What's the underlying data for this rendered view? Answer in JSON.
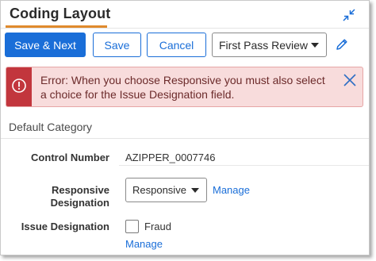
{
  "header": {
    "title": "Coding Layout"
  },
  "toolbar": {
    "save_next_label": "Save & Next",
    "save_label": "Save",
    "cancel_label": "Cancel",
    "layout_selected": "First Pass Review"
  },
  "error": {
    "message": "Error: When you choose Responsive you must also select a choice for the Issue Designation field."
  },
  "section": {
    "category": "Default Category"
  },
  "fields": {
    "control_number": {
      "label": "Control Number",
      "value": "AZIPPER_0007746"
    },
    "responsive": {
      "label": "Responsive Designation",
      "selected": "Responsive",
      "manage_label": "Manage"
    },
    "issue": {
      "label": "Issue Designation",
      "choices": [
        {
          "label": "Fraud",
          "checked": false
        }
      ],
      "manage_label": "Manage"
    }
  },
  "colors": {
    "primary": "#1a6ed8",
    "accent_underline": "#e08a2d",
    "error_stripe": "#c2363d",
    "error_background": "#f8dcdc"
  },
  "icons": {
    "collapse": "collapse-arrows-icon",
    "edit": "pencil-icon",
    "error": "exclamation-circle-icon",
    "close": "close-icon",
    "dropdown": "chevron-down-icon"
  }
}
